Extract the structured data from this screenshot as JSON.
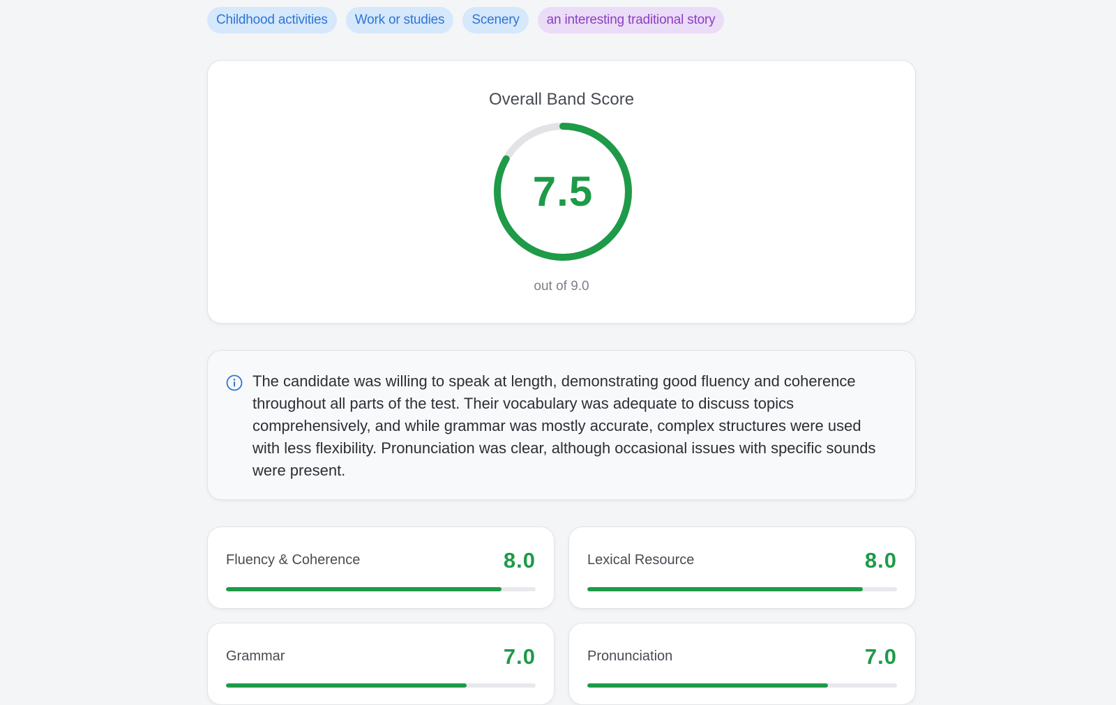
{
  "tags": [
    {
      "label": "Childhood activities",
      "variant": "blue"
    },
    {
      "label": "Work or studies",
      "variant": "blue"
    },
    {
      "label": "Scenery",
      "variant": "blue"
    },
    {
      "label": "an interesting traditional story",
      "variant": "purple"
    }
  ],
  "overall": {
    "label": "Overall Band Score",
    "score": "7.5",
    "out_of": "out of 9.0",
    "fraction": 0.8333,
    "ring_color": "#1e9a48",
    "track_color": "#e2e3e6"
  },
  "summary": {
    "icon": "info-icon",
    "text": "The candidate was willing to speak at length, demonstrating good fluency and coherence throughout all parts of the test. Their vocabulary was adequate to discuss topics comprehensively, and while grammar was mostly accurate, complex structures were used with less flexibility. Pronunciation was clear, although occasional issues with specific sounds were present."
  },
  "criteria": [
    {
      "label": "Fluency & Coherence",
      "score": "8.0",
      "fraction": 0.8889
    },
    {
      "label": "Lexical Resource",
      "score": "8.0",
      "fraction": 0.8889
    },
    {
      "label": "Grammar",
      "score": "7.0",
      "fraction": 0.7778
    },
    {
      "label": "Pronunciation",
      "score": "7.0",
      "fraction": 0.7778
    }
  ],
  "colors": {
    "accent_green": "#1e9a48",
    "tag_blue_bg": "#d6e8fb",
    "tag_blue_text": "#2f75d3",
    "tag_purple_bg": "#ebdcf7",
    "tag_purple_text": "#8a3fc4",
    "info_blue": "#2f75d3"
  }
}
